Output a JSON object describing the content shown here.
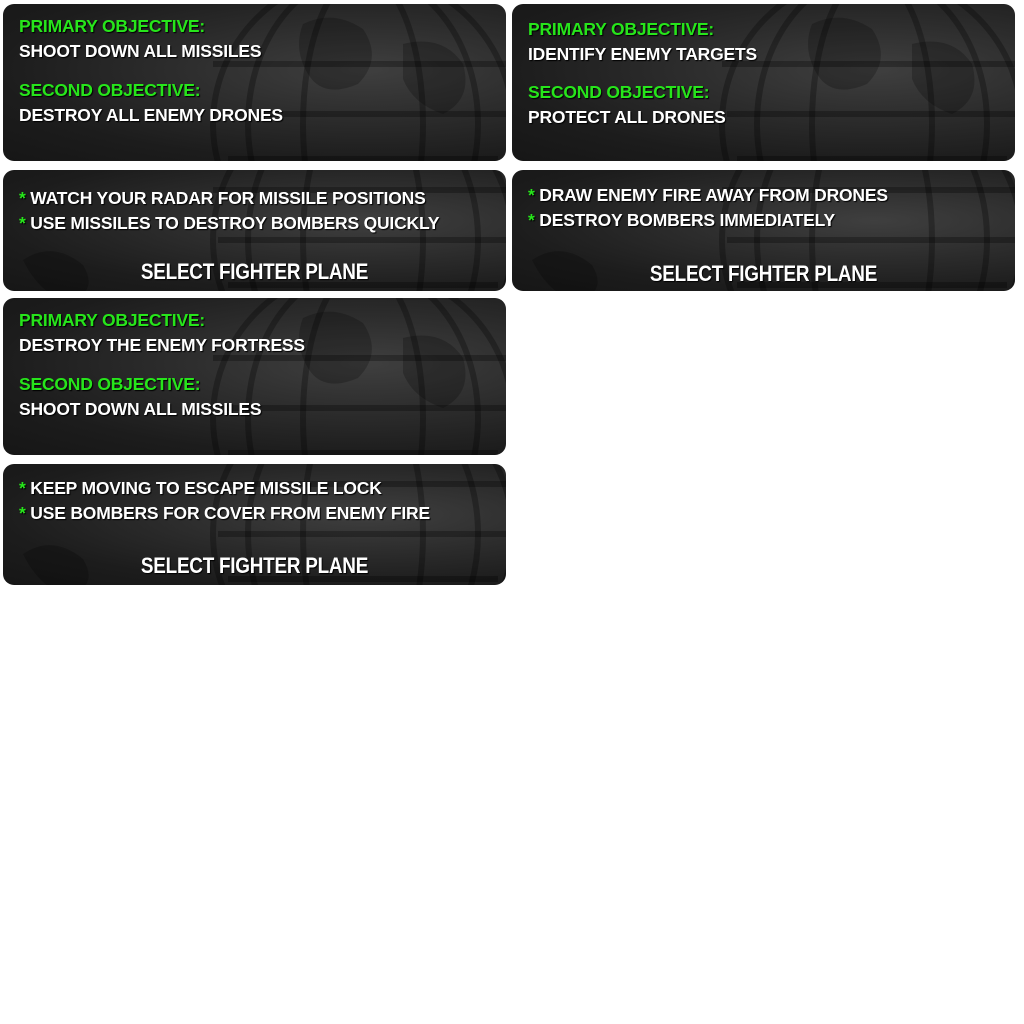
{
  "missions": [
    {
      "primary_label": "PRIMARY OBJECTIVE:",
      "primary_text": "SHOOT DOWN ALL MISSILES",
      "second_label": "SECOND OBJECTIVE:",
      "second_text": "DESTROY ALL ENEMY DRONES",
      "bullet_marker": "*",
      "tips": [
        "WATCH YOUR RADAR FOR MISSILE POSITIONS",
        "USE MISSILES TO DESTROY BOMBERS QUICKLY"
      ],
      "select_label": "SELECT FIGHTER PLANE"
    },
    {
      "primary_label": "PRIMARY OBJECTIVE:",
      "primary_text": "IDENTIFY ENEMY TARGETS",
      "second_label": "SECOND OBJECTIVE:",
      "second_text": "PROTECT ALL DRONES",
      "bullet_marker": "*",
      "tips": [
        "DRAW ENEMY FIRE AWAY FROM DRONES",
        "DESTROY BOMBERS IMMEDIATELY"
      ],
      "select_label": "SELECT FIGHTER PLANE"
    },
    {
      "primary_label": "PRIMARY OBJECTIVE:",
      "primary_text": "DESTROY THE ENEMY FORTRESS",
      "second_label": "SECOND OBJECTIVE:",
      "second_text": "SHOOT DOWN ALL MISSILES",
      "bullet_marker": "*",
      "tips": [
        "KEEP MOVING TO ESCAPE MISSILE LOCK",
        "USE BOMBERS FOR COVER FROM ENEMY FIRE"
      ],
      "select_label": "SELECT FIGHTER PLANE"
    }
  ],
  "colors": {
    "accent_green": "#27e51b",
    "panel_dark": "#1c1c1c",
    "text_white": "#ffffff"
  },
  "icons": {
    "background": "globe-icon"
  }
}
